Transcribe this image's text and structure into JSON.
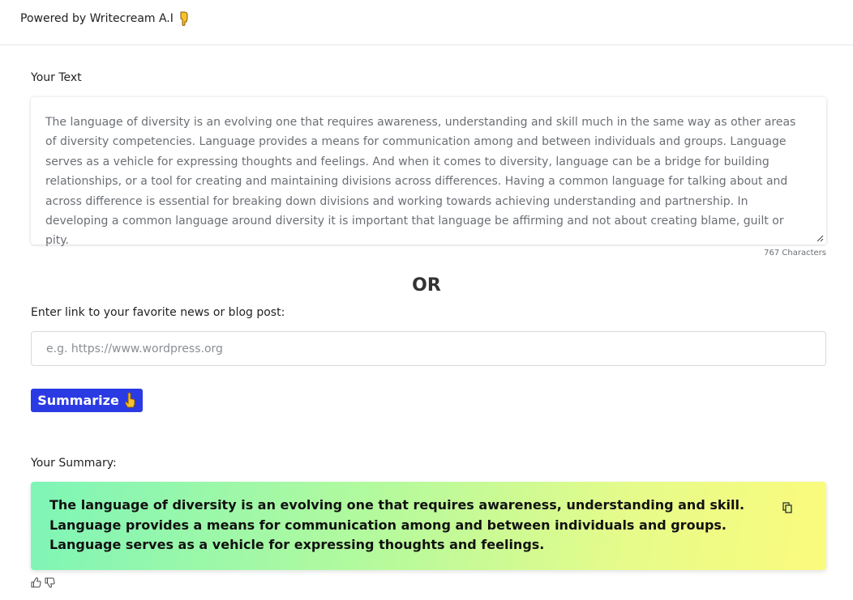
{
  "header": {
    "brand_text": "Powered by Writecream A.I",
    "brand_icon": "pointing-down-hand-icon"
  },
  "input_section": {
    "label": "Your Text",
    "text": "The language of diversity is an evolving one that requires awareness, understanding and skill much in the same way as other areas of diversity competencies. Language provides a means for communication among and between individuals and groups. Language serves as a vehicle for expressing thoughts and feelings. And when it comes to diversity, language can be a bridge for building relationships, or a tool for creating and maintaining divisions across differences. Having a common language for talking about and across difference is essential for breaking down divisions and working towards achieving understanding and partnership. In developing a common language around diversity it is important that language be affirming and not about creating blame, guilt or pity.",
    "char_count": "767 Characters"
  },
  "separator": "OR",
  "link_section": {
    "label": "Enter link to your favorite news or blog post:",
    "placeholder": "e.g. https://www.wordpress.org",
    "value": ""
  },
  "summarize_button": {
    "label": "Summarize",
    "icon": "pointing-up-hand-icon",
    "color": "#2a3be4"
  },
  "summary_section": {
    "label": "Your Summary:",
    "text": "The language of diversity is an evolving one that requires awareness, understanding and skill. Language provides a means for communication among and between individuals and groups. Language serves as a vehicle for expressing thoughts and feelings.",
    "copy_icon": "copy-icon",
    "gradient_colors": [
      "#7ef5b7",
      "#fbfb7c"
    ]
  },
  "feedback": {
    "like_icon": "thumbs-up-icon",
    "dislike_icon": "thumbs-down-icon"
  }
}
